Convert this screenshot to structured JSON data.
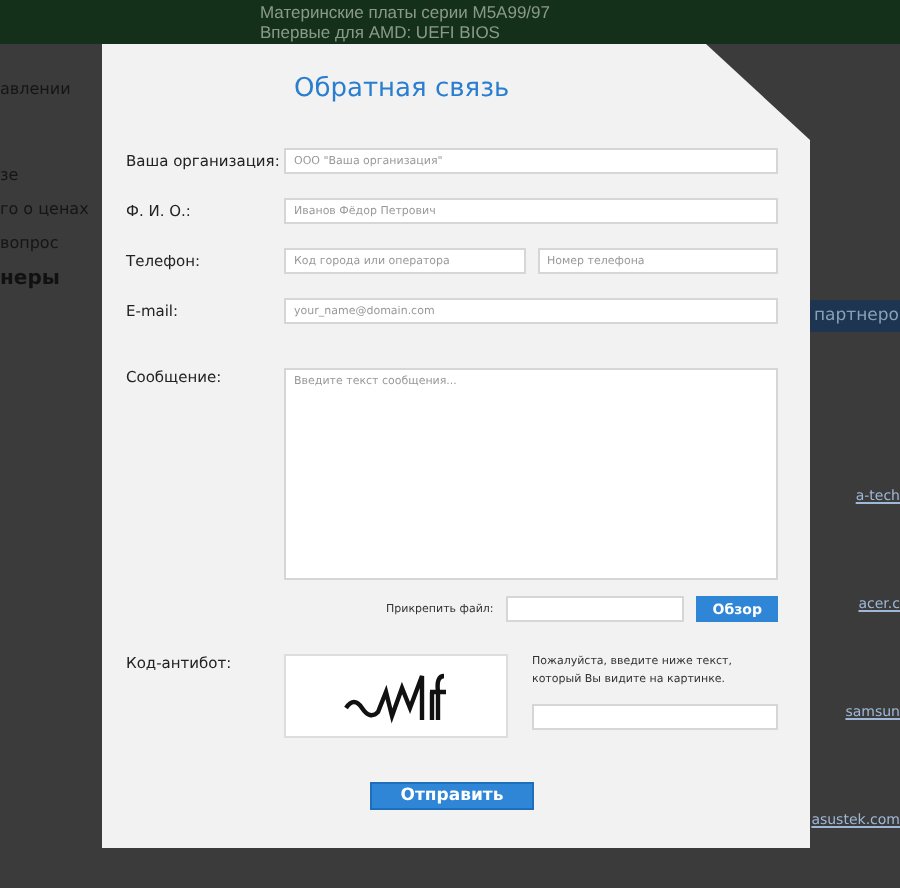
{
  "background_page": {
    "banner": [
      "Материнские платы серии M5A99/97",
      "Впервые для AMD: UEFI BIOS"
    ],
    "sidebar_items": [
      "авлении",
      "зе",
      "го о ценах",
      "вопрос"
    ],
    "sidebar_heading": "неры",
    "partners_heading": "партнеро",
    "partner_links": [
      "a-tech",
      "acer.c",
      "samsun",
      "asustek.com"
    ]
  },
  "dialog": {
    "title": "Обратная связь",
    "fields": [
      {
        "label": "Ваша организация:",
        "inputs": [
          {
            "placeholder": "ООО \"Ваша организация\""
          }
        ]
      },
      {
        "label": "Ф. И. О.:",
        "inputs": [
          {
            "placeholder": "Иванов Фёдор Петрович"
          }
        ]
      },
      {
        "label": "Телефон:",
        "inputs": [
          {
            "placeholder": "Код города или оператора"
          },
          {
            "placeholder": "Номер телефона"
          }
        ]
      },
      {
        "label": "E-mail:",
        "inputs": [
          {
            "placeholder": "your_name@domain.com"
          }
        ]
      }
    ],
    "message": {
      "label": "Сообщение:",
      "placeholder": "Введите текст сообщения..."
    },
    "attachment": {
      "label": "Прикрепить файл:",
      "button": "Обзор"
    },
    "captcha": {
      "label": "Код-антибот:",
      "hint": "Пожалуйста, введите ниже текст, который Вы видите на картинке."
    },
    "submit": "Отправить"
  }
}
